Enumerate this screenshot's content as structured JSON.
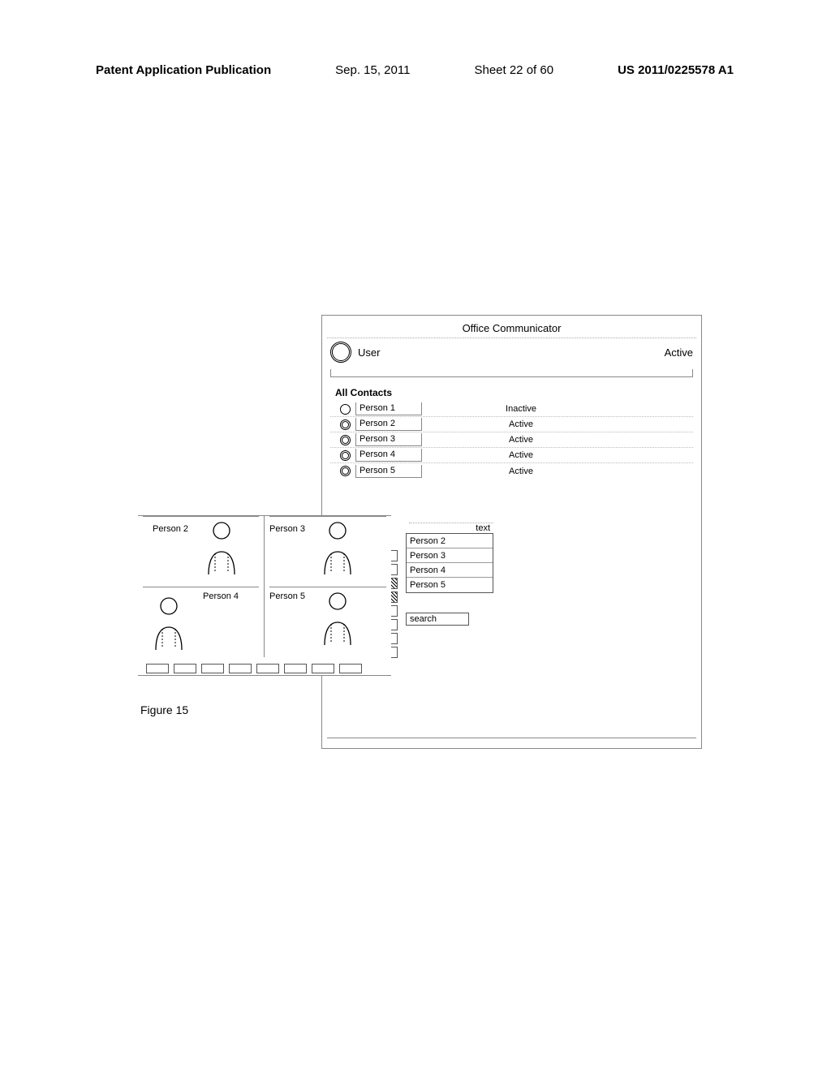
{
  "header": {
    "pub": "Patent Application Publication",
    "date": "Sep. 15, 2011",
    "sheet": "Sheet 22 of 60",
    "pubno": "US 2011/0225578 A1"
  },
  "communicator": {
    "title": "Office Communicator",
    "user": {
      "name": "User",
      "status": "Active"
    },
    "section_label": "All Contacts",
    "contacts": [
      {
        "name": "Person 1",
        "status": "Inactive",
        "active": false
      },
      {
        "name": "Person 2",
        "status": "Active",
        "active": true
      },
      {
        "name": "Person 3",
        "status": "Active",
        "active": true
      },
      {
        "name": "Person 4",
        "status": "Active",
        "active": true
      },
      {
        "name": "Person 5",
        "status": "Active",
        "active": true
      }
    ]
  },
  "popup": {
    "title": "text",
    "items": [
      "Person 2",
      "Person 3",
      "Person 4",
      "Person 5"
    ],
    "search_label": "search"
  },
  "stack": {
    "cells": [
      {
        "label": "Person 2"
      },
      {
        "label": "Person 3"
      },
      {
        "label": "Person 4"
      },
      {
        "label": "Person 5"
      }
    ]
  },
  "figure_label": "Figure 15"
}
